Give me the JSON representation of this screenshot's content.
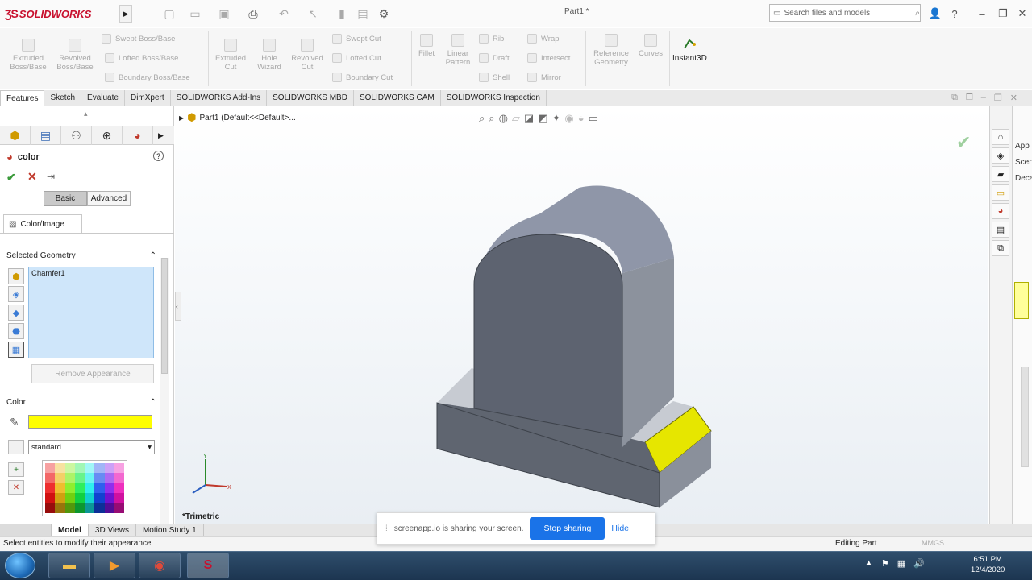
{
  "app": {
    "name": "SOLIDWORKS",
    "doc_title": "Part1 *"
  },
  "search": {
    "placeholder": "Search files and models"
  },
  "ribbon": {
    "buttons": [
      {
        "label": "Extruded Boss/Base"
      },
      {
        "label": "Revolved Boss/Base"
      },
      {
        "label": "Swept Boss/Base"
      },
      {
        "label": "Lofted Boss/Base"
      },
      {
        "label": "Boundary Boss/Base"
      },
      {
        "label": "Extruded Cut"
      },
      {
        "label": "Hole Wizard"
      },
      {
        "label": "Revolved Cut"
      },
      {
        "label": "Swept Cut"
      },
      {
        "label": "Lofted Cut"
      },
      {
        "label": "Boundary Cut"
      },
      {
        "label": "Fillet"
      },
      {
        "label": "Linear Pattern"
      },
      {
        "label": "Rib"
      },
      {
        "label": "Draft"
      },
      {
        "label": "Shell"
      },
      {
        "label": "Wrap"
      },
      {
        "label": "Intersect"
      },
      {
        "label": "Mirror"
      },
      {
        "label": "Reference Geometry"
      },
      {
        "label": "Curves"
      },
      {
        "label": "Instant3D"
      }
    ]
  },
  "tabs": [
    "Features",
    "Sketch",
    "Evaluate",
    "DimXpert",
    "SOLIDWORKS Add-Ins",
    "SOLIDWORKS MBD",
    "SOLIDWORKS CAM",
    "SOLIDWORKS Inspection"
  ],
  "tree": {
    "root": "Part1  (Default<<Default>..."
  },
  "property_manager": {
    "title": "color",
    "basic": "Basic",
    "advanced": "Advanced",
    "tab": "Color/Image",
    "selected_geometry_header": "Selected Geometry",
    "selected_items": [
      "Chamfer1"
    ],
    "remove_button": "Remove Appearance",
    "color_header": "Color",
    "color_value": "#ffff00",
    "palette_select": "standard"
  },
  "viewport": {
    "view_label": "*Trimetric"
  },
  "right_panel": {
    "labels": [
      "App",
      "Scen",
      "Deca"
    ]
  },
  "bottom_tabs": [
    "Model",
    "3D Views",
    "Motion Study 1"
  ],
  "status": {
    "message": "Select entities to modify their appearance",
    "mode": "Editing Part",
    "units": "MMGS"
  },
  "share_banner": {
    "text": "screenapp.io is sharing your screen.",
    "stop": "Stop sharing",
    "hide": "Hide"
  },
  "clock": {
    "time": "6:51 PM",
    "date": "12/4/2020"
  },
  "colors": {
    "accent_yellow": "#ffff00",
    "part_gray": "#6b717c",
    "share_blue": "#1a73e8"
  }
}
